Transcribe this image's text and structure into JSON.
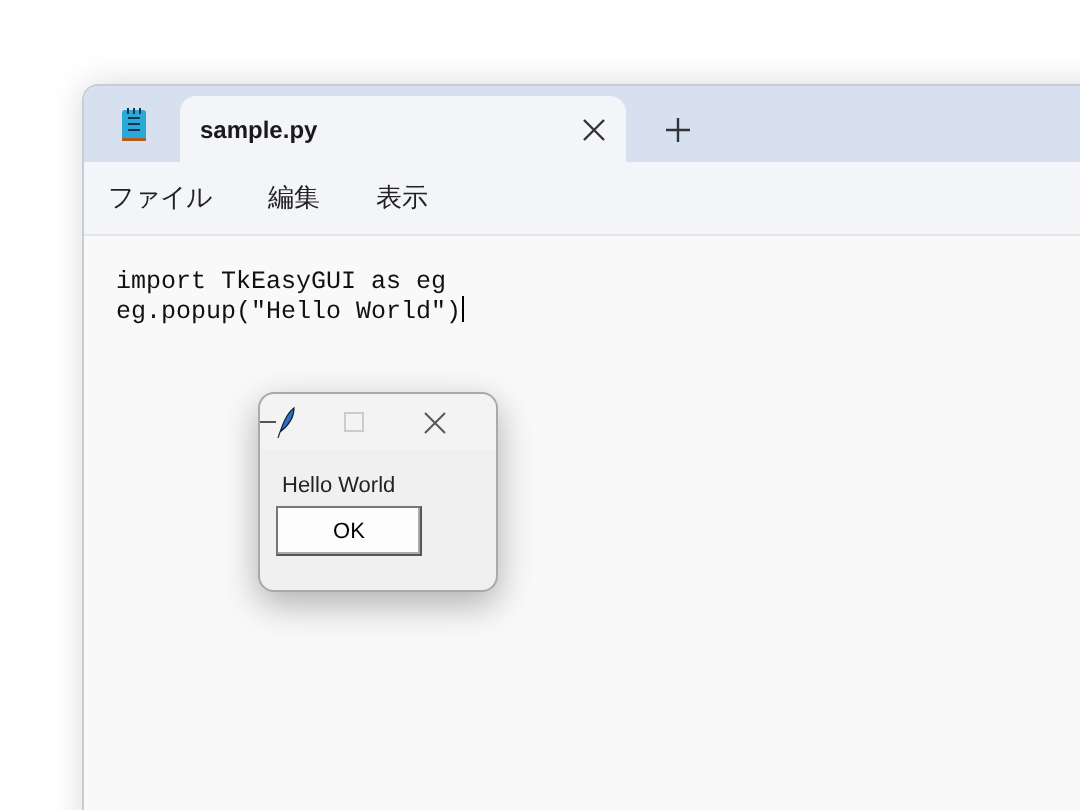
{
  "tabs": [
    {
      "label": "sample.py",
      "selected": true
    }
  ],
  "menu": [
    "ファイル",
    "編集",
    "表示"
  ],
  "editor": {
    "lines": [
      "import TkEasyGUI as eg",
      "eg.popup(\"Hello World\")"
    ]
  },
  "popup": {
    "message": "Hello World",
    "button": "OK"
  }
}
